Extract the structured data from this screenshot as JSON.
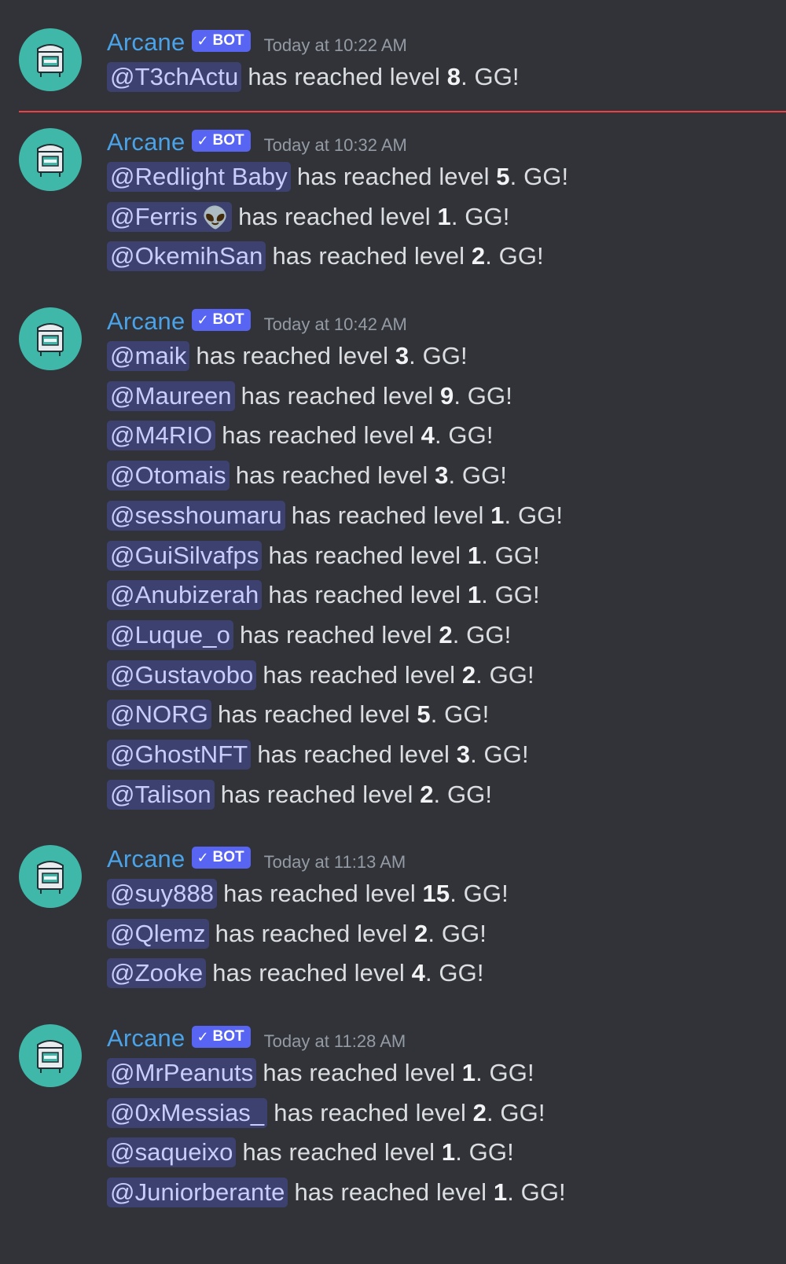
{
  "groups": [
    {
      "author": "Arcane",
      "bot_label": "BOT",
      "timestamp": "Today at 10:22 AM",
      "messages": [
        {
          "mention": "@T3chActu",
          "pre": "has reached level ",
          "level": "8",
          "post": ". GG!"
        }
      ]
    },
    {
      "author": "Arcane",
      "bot_label": "BOT",
      "timestamp": "Today at 10:32 AM",
      "messages": [
        {
          "mention": "@Redlight Baby",
          "pre": "has reached level ",
          "level": "5",
          "post": ". GG!"
        },
        {
          "mention": "@Ferris",
          "emoji": "👽",
          "pre": "has reached level ",
          "level": "1",
          "post": ". GG!"
        },
        {
          "mention": "@OkemihSan",
          "pre": "has reached level ",
          "level": "2",
          "post": ". GG!"
        }
      ]
    },
    {
      "author": "Arcane",
      "bot_label": "BOT",
      "timestamp": "Today at 10:42 AM",
      "messages": [
        {
          "mention": "@maik",
          "pre": "has reached level ",
          "level": "3",
          "post": ". GG!"
        },
        {
          "mention": "@Maureen",
          "pre": "has reached level ",
          "level": "9",
          "post": ". GG!"
        },
        {
          "mention": "@M4RIO",
          "pre": "has reached level ",
          "level": "4",
          "post": ". GG!"
        },
        {
          "mention": "@Otomais",
          "pre": "has reached level ",
          "level": "3",
          "post": ". GG!"
        },
        {
          "mention": "@sesshoumaru",
          "pre": "has reached level ",
          "level": "1",
          "post": ". GG!"
        },
        {
          "mention": "@GuiSilvafps",
          "pre": "has reached level ",
          "level": "1",
          "post": ". GG!"
        },
        {
          "mention": "@Anubizerah",
          "pre": "has reached level ",
          "level": "1",
          "post": ". GG!"
        },
        {
          "mention": "@Luque_o",
          "pre": "has reached level ",
          "level": "2",
          "post": ". GG!"
        },
        {
          "mention": "@Gustavobo",
          "pre": "has reached level ",
          "level": "2",
          "post": ". GG!"
        },
        {
          "mention": "@NORG",
          "pre": "has reached level ",
          "level": "5",
          "post": ". GG!"
        },
        {
          "mention": "@GhostNFT",
          "pre": "has reached level ",
          "level": "3",
          "post": ". GG!"
        },
        {
          "mention": "@Talison",
          "pre": "has reached level ",
          "level": "2",
          "post": ". GG!"
        }
      ]
    },
    {
      "author": "Arcane",
      "bot_label": "BOT",
      "timestamp": "Today at 11:13 AM",
      "messages": [
        {
          "mention": "@suy888",
          "pre": "has reached level ",
          "level": "15",
          "post": ". GG!"
        },
        {
          "mention": "@Qlemz",
          "pre": "has reached level ",
          "level": "2",
          "post": ". GG!"
        },
        {
          "mention": "@Zooke",
          "pre": "has reached level ",
          "level": "4",
          "post": ". GG!"
        }
      ]
    },
    {
      "author": "Arcane",
      "bot_label": "BOT",
      "timestamp": "Today at 11:28 AM",
      "messages": [
        {
          "mention": "@MrPeanuts",
          "pre": "has reached level ",
          "level": "1",
          "post": ". GG!"
        },
        {
          "mention": "@0xMessias_",
          "pre": "has reached level ",
          "level": "2",
          "post": ". GG!"
        },
        {
          "mention": "@saqueixo",
          "pre": "has reached level ",
          "level": "1",
          "post": ". GG!"
        },
        {
          "mention": "@Juniorberante",
          "pre": "has reached level ",
          "level": "1",
          "post": ". GG!"
        }
      ]
    }
  ],
  "colors": {
    "background": "#313338",
    "author": "#4aa3e8",
    "bot_tag": "#5865f2",
    "mention_text": "#c9cdfb",
    "new_messages_divider": "#f23f43",
    "avatar": "#3fb8a9"
  },
  "icons": {
    "avatar": "arcane-bot-avatar-icon",
    "bot_check": "check-icon"
  }
}
